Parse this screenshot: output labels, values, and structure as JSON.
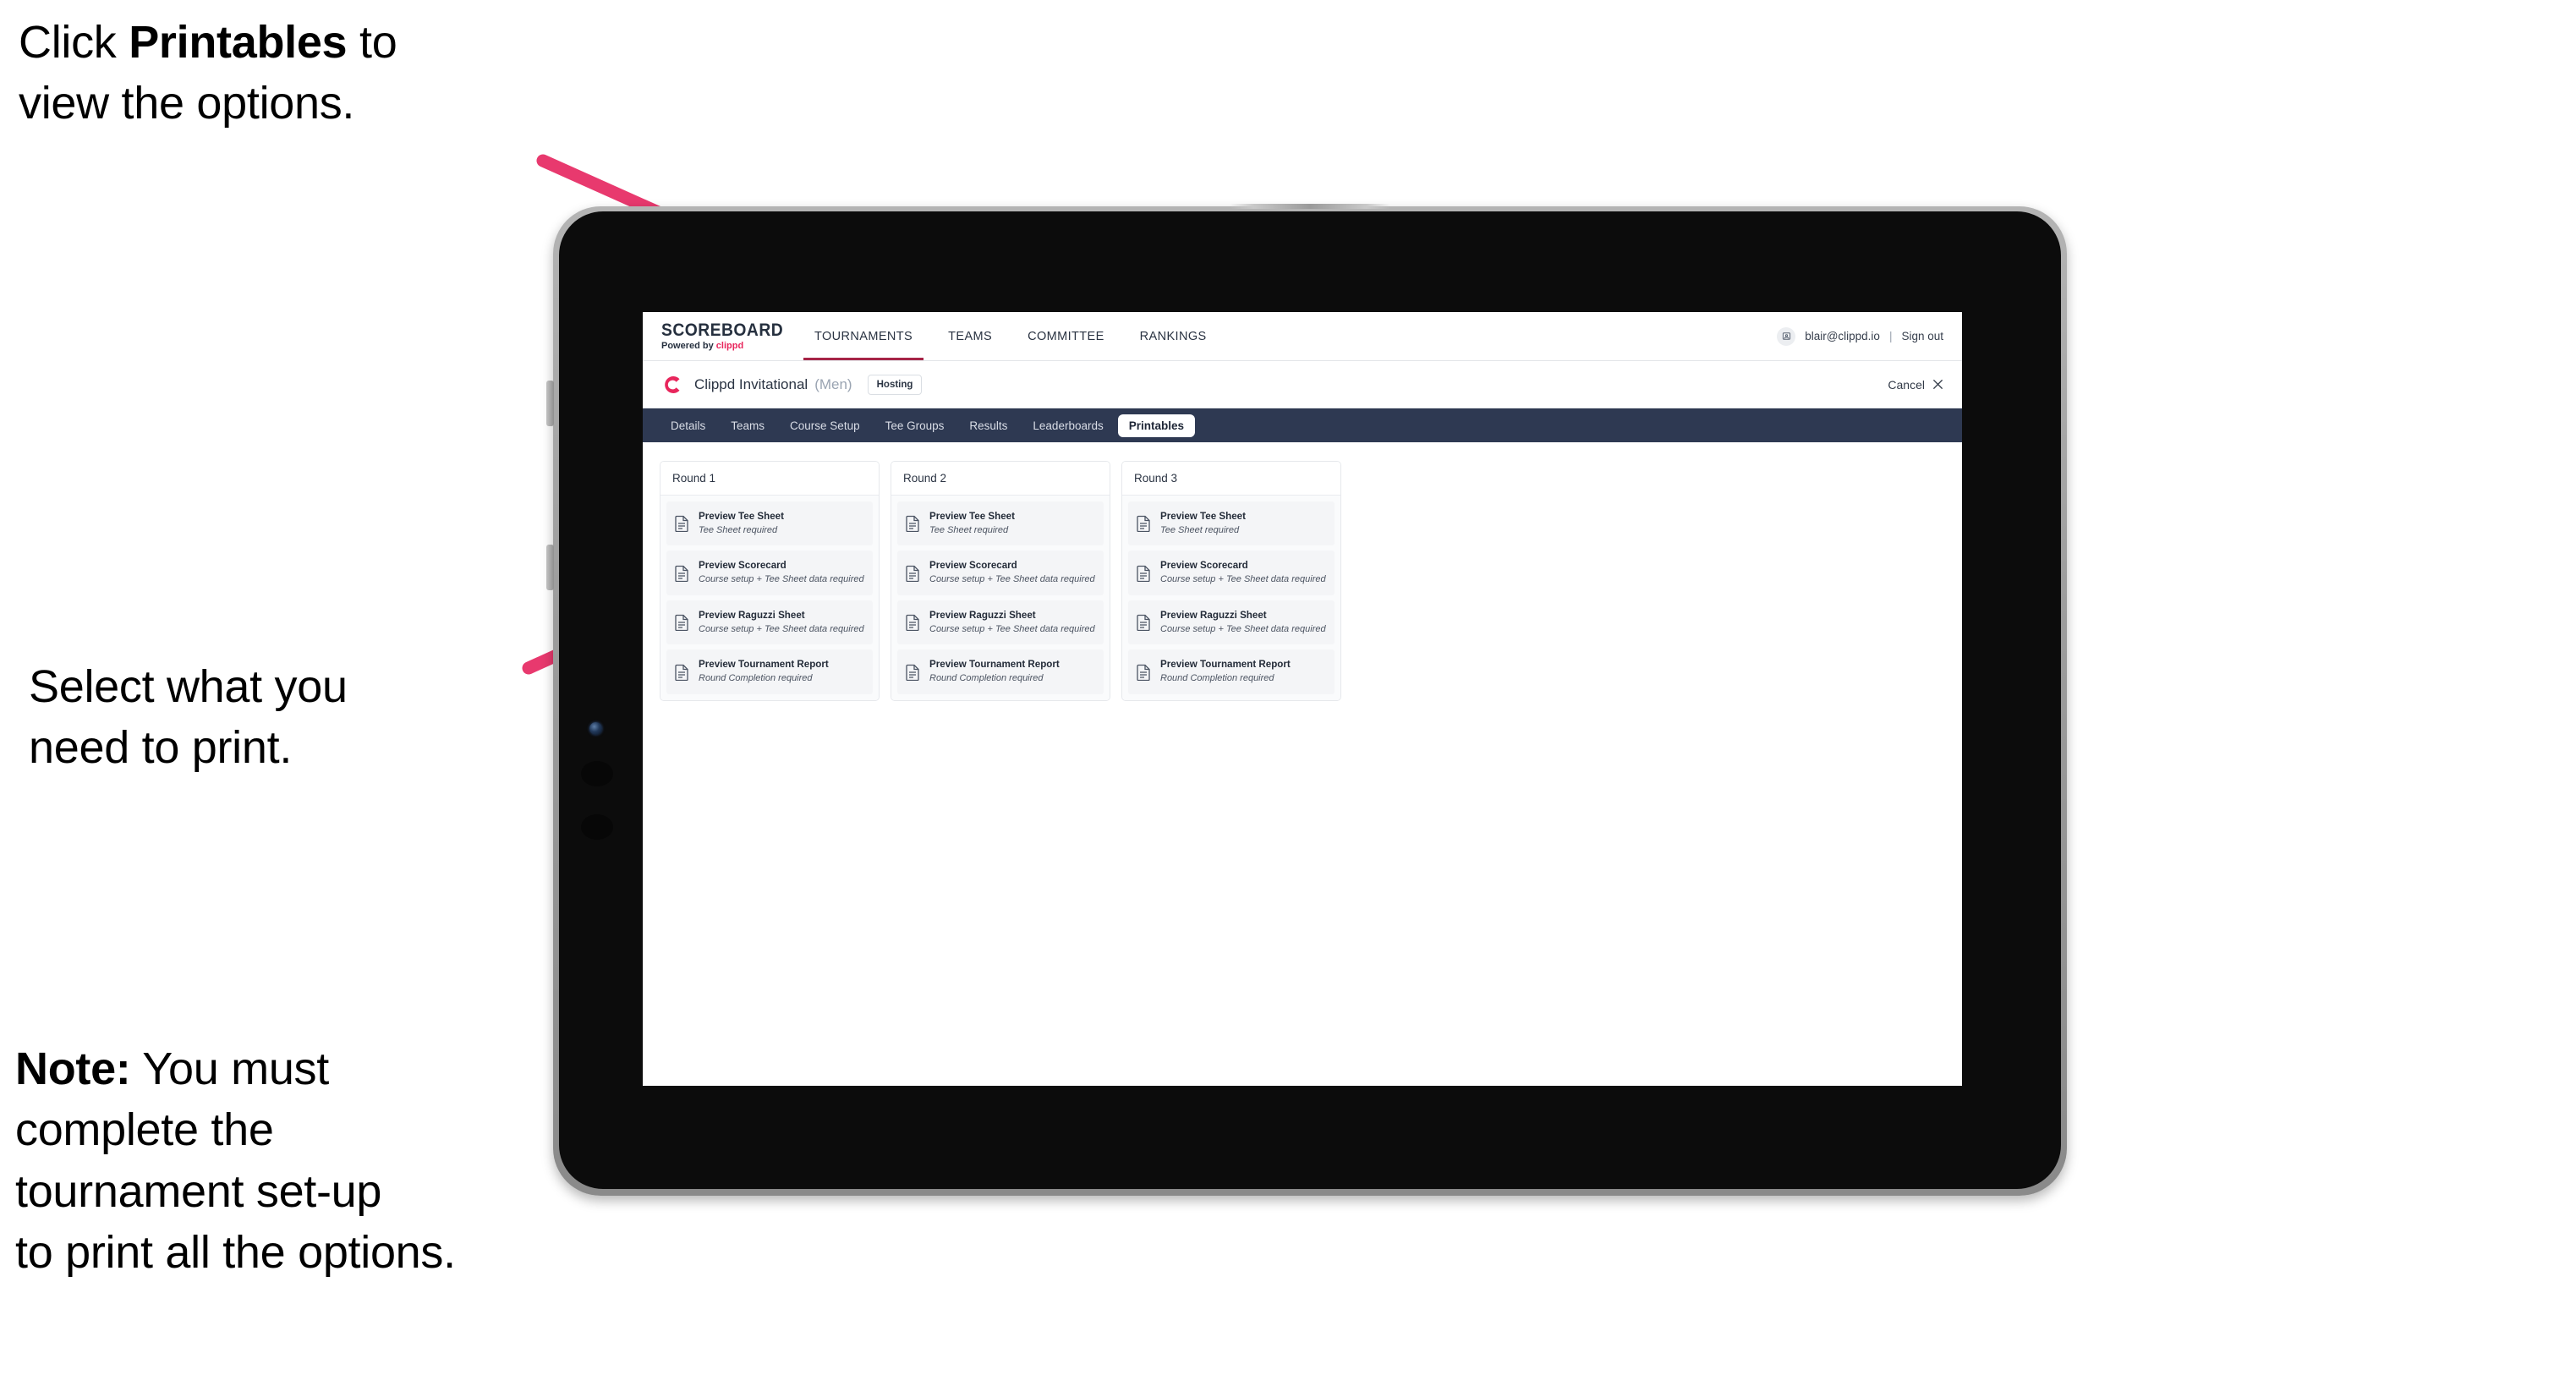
{
  "annotations": {
    "click_printables": "Click Printables to\nview the options.",
    "click_printables_lead": "Click ",
    "click_printables_bold": "Printables",
    "click_printables_tail": " to\nview the options.",
    "select_print": "Select what you\n need to print.",
    "note_bold": "Note:",
    "note_text": " You must\ncomplete the\ntournament set-up\nto print all the options.",
    "accent_color": "#e8396e"
  },
  "app": {
    "brand": {
      "name": "SCOREBOARD",
      "powered_prefix": "Powered by ",
      "powered_brand": "clippd"
    },
    "topnav": [
      {
        "label": "TOURNAMENTS",
        "active": true
      },
      {
        "label": "TEAMS",
        "active": false
      },
      {
        "label": "COMMITTEE",
        "active": false
      },
      {
        "label": "RANKINGS",
        "active": false
      }
    ],
    "account": {
      "avatar_icon": "user-avatar-icon",
      "email": "blair@clippd.io",
      "separator": "|",
      "sign_out": "Sign out"
    },
    "event": {
      "logo_icon": "clippd-c-logo-icon",
      "title": "Clippd Invitational",
      "gender": "(Men)",
      "status_badge": "Hosting",
      "cancel_label": "Cancel",
      "cancel_icon": "close-x-icon"
    },
    "tabs": [
      {
        "label": "Details",
        "active": false
      },
      {
        "label": "Teams",
        "active": false
      },
      {
        "label": "Course Setup",
        "active": false
      },
      {
        "label": "Tee Groups",
        "active": false
      },
      {
        "label": "Results",
        "active": false
      },
      {
        "label": "Leaderboards",
        "active": false
      },
      {
        "label": "Printables",
        "active": true
      }
    ],
    "rounds": [
      {
        "title": "Round 1",
        "items": [
          {
            "title": "Preview Tee Sheet",
            "requirement": "Tee Sheet required",
            "icon": "document-icon"
          },
          {
            "title": "Preview Scorecard",
            "requirement": "Course setup + Tee Sheet data required",
            "icon": "document-icon"
          },
          {
            "title": "Preview Raguzzi Sheet",
            "requirement": "Course setup + Tee Sheet data required",
            "icon": "document-icon"
          },
          {
            "title": "Preview Tournament Report",
            "requirement": "Round Completion required",
            "icon": "document-icon"
          }
        ]
      },
      {
        "title": "Round 2",
        "items": [
          {
            "title": "Preview Tee Sheet",
            "requirement": "Tee Sheet required",
            "icon": "document-icon"
          },
          {
            "title": "Preview Scorecard",
            "requirement": "Course setup + Tee Sheet data required",
            "icon": "document-icon"
          },
          {
            "title": "Preview Raguzzi Sheet",
            "requirement": "Course setup + Tee Sheet data required",
            "icon": "document-icon"
          },
          {
            "title": "Preview Tournament Report",
            "requirement": "Round Completion required",
            "icon": "document-icon"
          }
        ]
      },
      {
        "title": "Round 3",
        "items": [
          {
            "title": "Preview Tee Sheet",
            "requirement": "Tee Sheet required",
            "icon": "document-icon"
          },
          {
            "title": "Preview Scorecard",
            "requirement": "Course setup + Tee Sheet data required",
            "icon": "document-icon"
          },
          {
            "title": "Preview Raguzzi Sheet",
            "requirement": "Course setup + Tee Sheet data required",
            "icon": "document-icon"
          },
          {
            "title": "Preview Tournament Report",
            "requirement": "Round Completion required",
            "icon": "document-icon"
          }
        ]
      }
    ],
    "colors": {
      "tabbar_bg": "#2e3952",
      "brand_pink": "#e8265c",
      "nav_underline": "#a62447"
    }
  }
}
